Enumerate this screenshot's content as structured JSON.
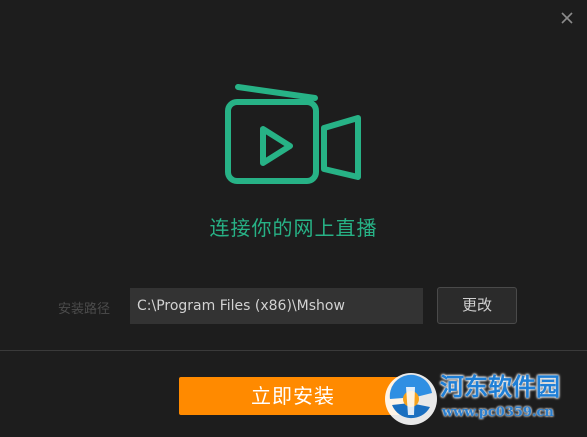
{
  "window": {
    "close_icon": "close-icon"
  },
  "logo": {
    "icon": "video-camera-play-icon",
    "color": "#27b286"
  },
  "tagline": "连接你的网上直播",
  "install_path": {
    "label": "安装路径",
    "value": "C:\\Program Files (x86)\\Mshow",
    "change_label": "更改"
  },
  "install_button": {
    "label": "立即安装",
    "color": "#ff8a00"
  },
  "watermark": {
    "title": "河东软件园",
    "url": "www.pc0359.cn"
  }
}
